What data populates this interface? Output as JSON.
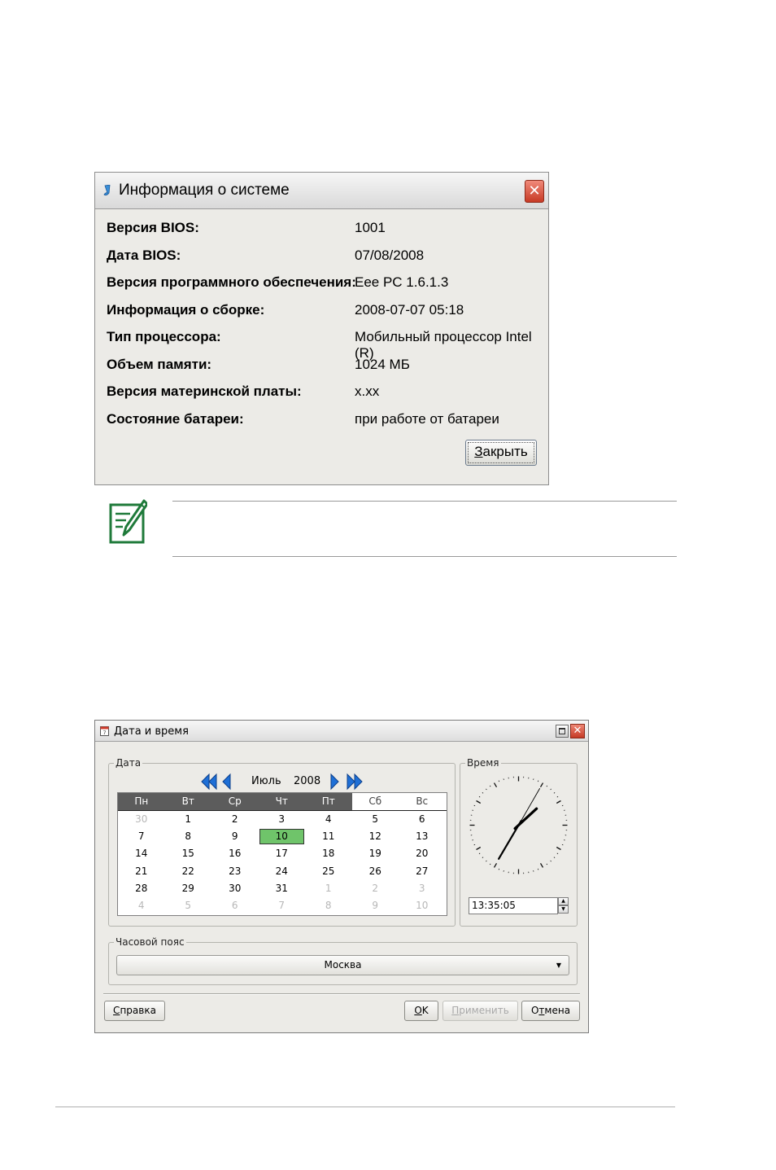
{
  "system_info": {
    "title": "Информация о системе",
    "close_glyph": "✕",
    "rows": [
      {
        "label": "Версия BIOS:",
        "value": "1001"
      },
      {
        "label": "Дата BIOS:",
        "value": "07/08/2008"
      },
      {
        "label": "Версия программного обеспечения:",
        "value": "Eee PC 1.6.1.3"
      },
      {
        "label": "Информация о сборке:",
        "value": "2008-07-07 05:18"
      },
      {
        "label": "Тип процессора:",
        "value": "Мобильный процессор Intel (R)"
      },
      {
        "label": "Объем памяти:",
        "value": "1024 МБ"
      },
      {
        "label": "Версия материнской платы:",
        "value": "x.xx"
      },
      {
        "label": "Состояние батареи:",
        "value": "при работе от батареи"
      }
    ],
    "close_button": {
      "mnemonic": "З",
      "rest": "акрыть"
    }
  },
  "datetime": {
    "title": "Дата и время",
    "close_glyph": "✕",
    "date_group": "Дата",
    "time_group": "Время",
    "timezone_group": "Часовой пояс",
    "month": "Июль",
    "year": "2008",
    "weekdays": [
      "Пн",
      "Вт",
      "Ср",
      "Чт",
      "Пт",
      "Сб",
      "Вс"
    ],
    "weeks": [
      [
        "30",
        "1",
        "2",
        "3",
        "4",
        "5",
        "6"
      ],
      [
        "7",
        "8",
        "9",
        "10",
        "11",
        "12",
        "13"
      ],
      [
        "14",
        "15",
        "16",
        "17",
        "18",
        "19",
        "20"
      ],
      [
        "21",
        "22",
        "23",
        "24",
        "25",
        "26",
        "27"
      ],
      [
        "28",
        "29",
        "30",
        "31",
        "1",
        "2",
        "3"
      ],
      [
        "4",
        "5",
        "6",
        "7",
        "8",
        "9",
        "10"
      ]
    ],
    "selected_day": "10",
    "time_value": "13:35:05",
    "clock": {
      "hour": 13,
      "minute": 35,
      "second": 5
    },
    "timezone": "Москва",
    "buttons": {
      "help": {
        "mnemonic": "С",
        "rest": "правка"
      },
      "ok": {
        "mnemonic": "O",
        "rest": "K"
      },
      "apply": {
        "mnemonic": "П",
        "rest": "рименить"
      },
      "cancel": {
        "pre": "О",
        "mnemonic": "т",
        "rest": "мена"
      }
    }
  },
  "colors": {
    "selected_day": "#6fc46a",
    "header_bg": "#5c5c5c",
    "nav_arrow": "#1e6fd6"
  }
}
